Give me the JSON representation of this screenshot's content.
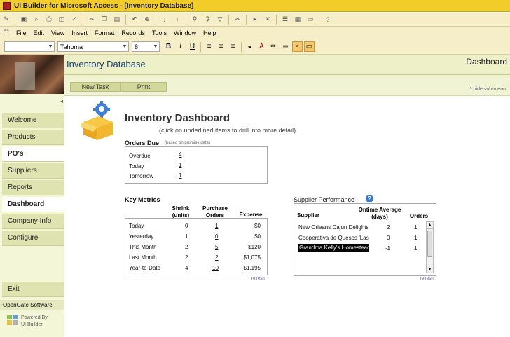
{
  "window": {
    "title": "UI Builder for Microsoft Access - [Inventory Database]"
  },
  "menu": [
    "File",
    "Edit",
    "View",
    "Insert",
    "Format",
    "Records",
    "Tools",
    "Window",
    "Help"
  ],
  "format_bar": {
    "object_value": "",
    "font": "Tahoma",
    "size": "8",
    "bold": "B",
    "italic": "I",
    "underline": "U"
  },
  "header": {
    "db_title": "Inventory Database",
    "page": "Dashboard"
  },
  "subbar": {
    "new_task": "New Task",
    "print": "Print",
    "hide": "^ hide sub-menu"
  },
  "sidebar": {
    "items": [
      {
        "label": "Welcome",
        "active": false
      },
      {
        "label": "Products",
        "active": false
      },
      {
        "label": "PO's",
        "active": true
      },
      {
        "label": "Suppliers",
        "active": false
      },
      {
        "label": "Reports",
        "active": false
      },
      {
        "label": "Dashboard",
        "active": true
      },
      {
        "label": "Company Info",
        "active": false
      },
      {
        "label": "Configure",
        "active": false
      }
    ],
    "exit": "Exit",
    "footer": "OpenGate Software",
    "powered_line1": "Powered By",
    "powered_line2": "UI Builder"
  },
  "dashboard": {
    "title": "Inventory Dashboard",
    "subtitle": "(click on underlined items to drill into more detail)"
  },
  "orders_due": {
    "title": "Orders Due",
    "note": "(based on promise date)",
    "rows": [
      {
        "label": "Overdue",
        "value": "4"
      },
      {
        "label": "Today",
        "value": "1"
      },
      {
        "label": "Tomorrow",
        "value": "1"
      }
    ]
  },
  "key_metrics": {
    "title": "Key Metrics",
    "headers": [
      "Shrink (units)",
      "Purchase Orders",
      "Expense"
    ],
    "rows": [
      {
        "label": "Today",
        "shrink": "0",
        "po": "1",
        "expense": "$0"
      },
      {
        "label": "Yesterday",
        "shrink": "1",
        "po": "0",
        "expense": "$0"
      },
      {
        "label": "This Month",
        "shrink": "2",
        "po": "5",
        "expense": "$120"
      },
      {
        "label": "Last Month",
        "shrink": "2",
        "po": "2",
        "expense": "$1,075"
      },
      {
        "label": "Year-to-Date",
        "shrink": "4",
        "po": "10",
        "expense": "$1,195"
      }
    ],
    "refresh": "refresh"
  },
  "supplier_performance": {
    "title": "Supplier Performance",
    "headers": [
      "Supplier",
      "Ontime Average (days)",
      "Orders"
    ],
    "rows": [
      {
        "supplier": "New Orleans Cajun Delights",
        "ontime": "2",
        "orders": "1",
        "selected": false
      },
      {
        "supplier": "Cooperativa de Quesos 'Las",
        "ontime": "0",
        "orders": "1",
        "selected": false
      },
      {
        "supplier": "Grandma Kelly's Homestead",
        "ontime": "-1",
        "orders": "1",
        "selected": true
      }
    ],
    "refresh": "refresh"
  },
  "colors": {
    "title_bar": "#f2cd2a",
    "nav_bg": "#dfe3b0",
    "header_bg": "#eef1c8",
    "db_title": "#1a3e7a"
  }
}
